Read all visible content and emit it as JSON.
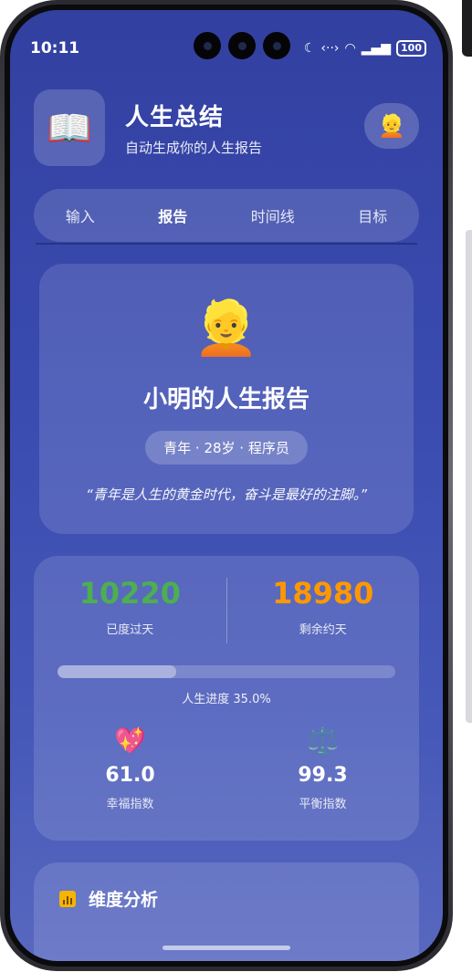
{
  "status": {
    "time": "10:11",
    "battery": "100"
  },
  "header": {
    "logo_icon": "📖",
    "title": "人生总结",
    "subtitle": "自动生成你的人生报告",
    "avatar_icon": "👱"
  },
  "tabs": [
    {
      "label": "输入",
      "active": false
    },
    {
      "label": "报告",
      "active": true
    },
    {
      "label": "时间线",
      "active": false
    },
    {
      "label": "目标",
      "active": false
    }
  ],
  "profile": {
    "emoji": "👱",
    "name": "小明的人生报告",
    "tag": "青年 · 28岁 · 程序员",
    "quote": "“青年是人生的黄金时代，奋斗是最好的注脚。”"
  },
  "stats": {
    "lived_days": "10220",
    "lived_label": "已度过天",
    "lived_color": "#4caf50",
    "remaining_days": "18980",
    "remaining_label": "剩余约天",
    "remaining_color": "#ff9800",
    "progress_fraction": 0.35,
    "progress_label": "人生进度 35.0%",
    "happiness": {
      "icon": "💖",
      "value": "61.0",
      "label": "幸福指数"
    },
    "balance": {
      "icon": "⚖️",
      "value": "99.3",
      "label": "平衡指数"
    }
  },
  "dimension": {
    "title": "维度分析"
  }
}
